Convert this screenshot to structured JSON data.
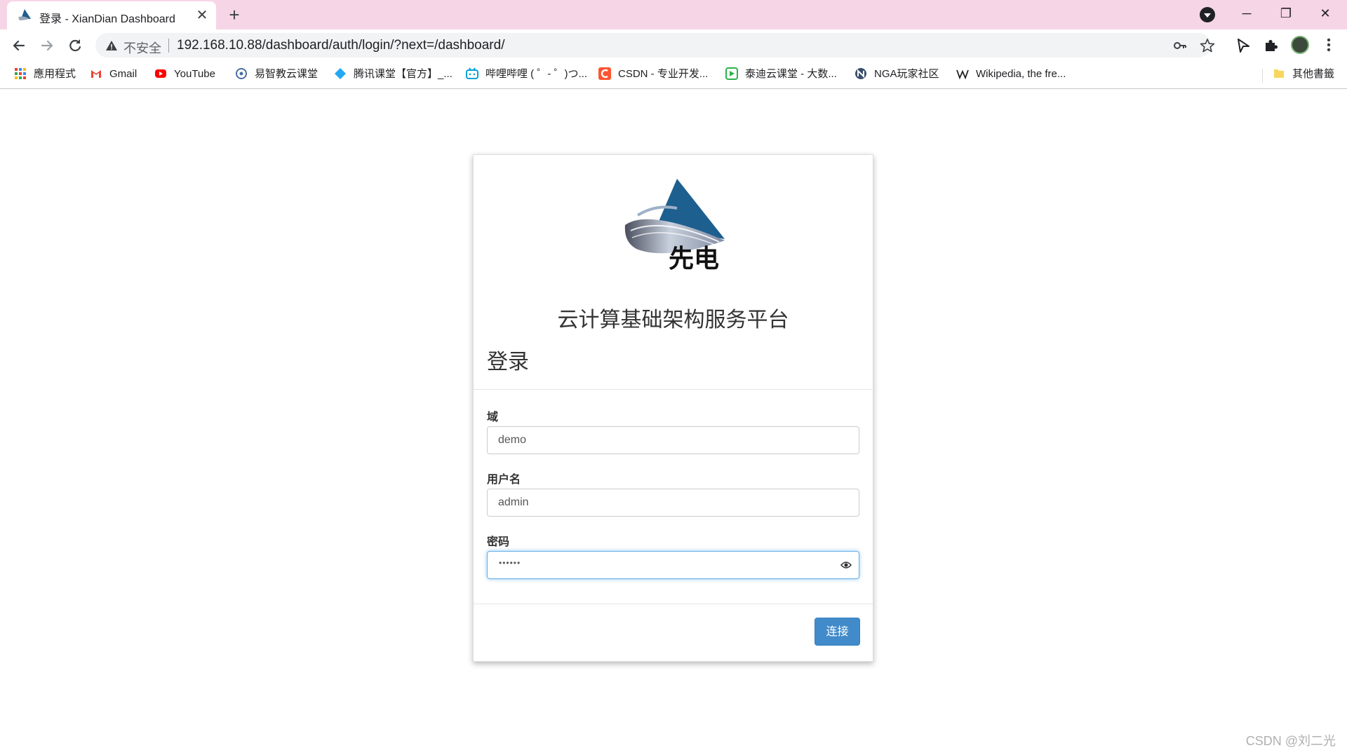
{
  "browser": {
    "tab": {
      "title": "登录 - XianDian Dashboard",
      "close_icon": "close-icon",
      "favicon": "xiandian-logo-icon"
    },
    "new_tab_label": "+",
    "window_controls": {
      "minimize": "─",
      "restore": "❐",
      "close": "✕"
    },
    "address_bar": {
      "security_label": "不安全",
      "url": "192.168.10.88/dashboard/auth/login/?next=/dashboard/"
    }
  },
  "bookmarks": [
    {
      "label": "應用程式",
      "icon": "apps-grid-icon"
    },
    {
      "label": "Gmail",
      "icon": "gmail-icon"
    },
    {
      "label": "YouTube",
      "icon": "youtube-icon"
    },
    {
      "label": "易智教云课堂",
      "icon": "yizhijiao-icon"
    },
    {
      "label": "腾讯课堂【官方】_...",
      "icon": "tencent-classroom-icon"
    },
    {
      "label": "哔哩哔哩 ( ゜- ゜)つ...",
      "icon": "bilibili-icon"
    },
    {
      "label": "CSDN - 专业开发...",
      "icon": "csdn-icon"
    },
    {
      "label": "泰迪云课堂 - 大数...",
      "icon": "taidi-icon"
    },
    {
      "label": "NGA玩家社区",
      "icon": "nga-icon"
    },
    {
      "label": "Wikipedia, the fre...",
      "icon": "wikipedia-icon"
    }
  ],
  "other_bookmarks": "其他書籤",
  "login": {
    "logo_text": "先电",
    "platform_title": "云计算基础架构服务平台",
    "heading": "登录",
    "domain": {
      "label": "域",
      "value": "demo"
    },
    "username": {
      "label": "用户名",
      "value": "admin"
    },
    "password": {
      "label": "密码",
      "masked_value": "••••••"
    },
    "submit_label": "连接"
  },
  "watermark": "CSDN @刘二光",
  "colors": {
    "tabstrip": "#f6d5e6",
    "primary_button": "#428bca",
    "focus_border": "#66afe9"
  }
}
